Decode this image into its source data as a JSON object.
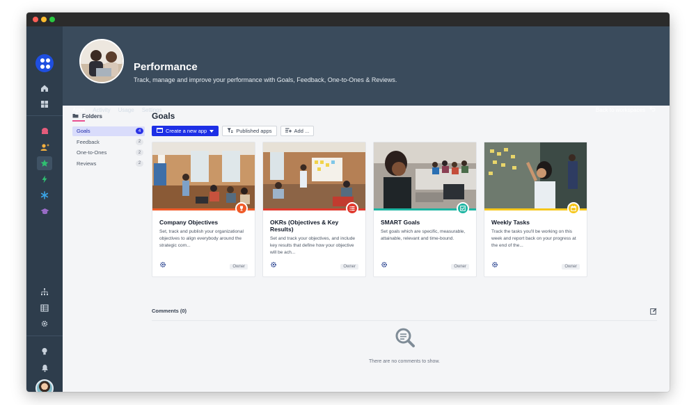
{
  "workspace": {
    "title": "Performance",
    "subtitle": "Track, manage and improve your performance with Goals, Feedback, One-to-Ones & Reviews.",
    "back_label": "Back to workspaces"
  },
  "tabs": [
    {
      "label": "Apps",
      "active": true
    },
    {
      "label": "Activity",
      "active": false
    },
    {
      "label": "Usage",
      "active": false
    },
    {
      "label": "Settings",
      "active": false
    }
  ],
  "folders": {
    "heading": "Folders",
    "items": [
      {
        "label": "Goals",
        "count": "4",
        "active": true
      },
      {
        "label": "Feedback",
        "count": "2",
        "active": false
      },
      {
        "label": "One-to-Ones",
        "count": "2",
        "active": false
      },
      {
        "label": "Reviews",
        "count": "2",
        "active": false
      }
    ]
  },
  "main": {
    "title": "Goals",
    "create_label": "Create a new app",
    "published_label": "Published apps",
    "add_label": "Add ..."
  },
  "cards": [
    {
      "title": "Company Objectives",
      "desc": "Set, track and publish your organizational objectives to align everybody around the strategic com...",
      "owner": "Owner",
      "accent": "#f05a28",
      "icon": "trophy-icon"
    },
    {
      "title": "OKRs (Objectives & Key Results)",
      "desc": "Set and track your objectives, and include key results that define how your objective will be ach...",
      "owner": "Owner",
      "accent": "#e03a2f",
      "icon": "list-icon"
    },
    {
      "title": "SMART Goals",
      "desc": "Set goals which are specific, measurable, attainable, relevant and time-bound.",
      "owner": "Owner",
      "accent": "#1db5a2",
      "icon": "checkbox-icon"
    },
    {
      "title": "Weekly Tasks",
      "desc": "Track the tasks you'll be working on this week and report back on your progress at the end of the...",
      "owner": "Owner",
      "accent": "#f6c71c",
      "icon": "calendar-icon"
    }
  ],
  "comments": {
    "heading": "Comments (0)",
    "empty_text": "There are no comments to show."
  },
  "colors": {
    "rail": "#2e3d4c",
    "header": "#3a4b5c",
    "primary": "#1d2fe6",
    "tab_underline": "#e84f90"
  }
}
